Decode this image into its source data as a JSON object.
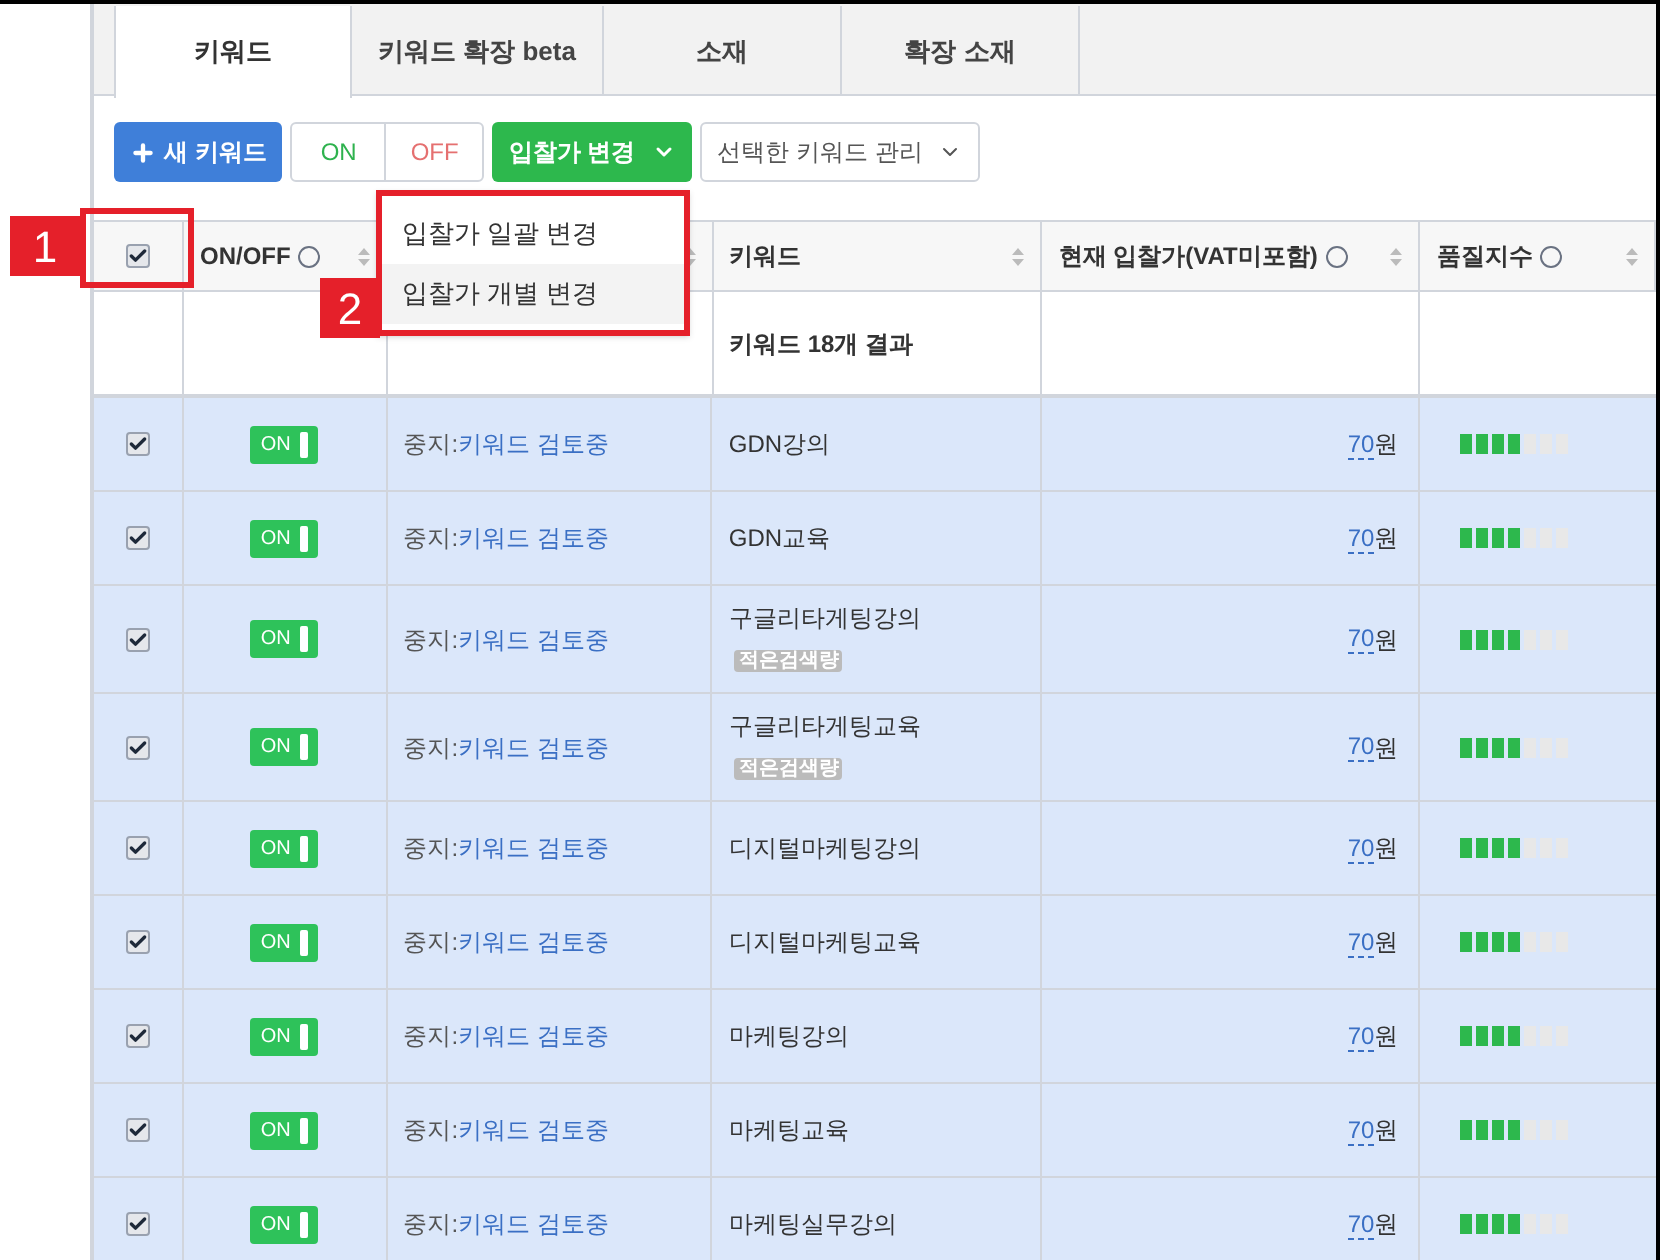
{
  "tabs": [
    {
      "label": "키워드",
      "selected": true
    },
    {
      "label": "키워드 확장 beta",
      "selected": false
    },
    {
      "label": "소재",
      "selected": false
    },
    {
      "label": "확장 소재",
      "selected": false
    }
  ],
  "toolbar": {
    "new_button": "새 키워드",
    "on_button": "ON",
    "off_button": "OFF",
    "bid_button": "입찰가 변경",
    "manage_button": "선택한 키워드 관리"
  },
  "bid_menu": {
    "items": [
      {
        "label": "입찰가 일괄 변경",
        "selected": false
      },
      {
        "label": "입찰가 개별 변경",
        "selected": true
      }
    ]
  },
  "annotations": [
    {
      "text": "1"
    },
    {
      "text": "2"
    }
  ],
  "table": {
    "header_checked": true,
    "columns": [
      {
        "kind": "help",
        "label": "ON/OFF"
      },
      {
        "kind": "blank"
      },
      {
        "kind": "plain",
        "label": "키워드"
      },
      {
        "kind": "help",
        "label": "현재 입찰가(VAT미포함)"
      },
      {
        "kind": "help",
        "label": "품질지수"
      }
    ],
    "summary": "키워드 18개 결과",
    "rows": [
      {
        "checked": true,
        "on": true,
        "toggle": "ON",
        "status": "중지:",
        "status_link": "키워드 검토중",
        "keyword": "GDN강의",
        "bid": "70",
        "unit": "원",
        "quality": {
          "level": 0.57
        }
      },
      {
        "checked": true,
        "on": true,
        "toggle": "ON",
        "status": "중지:",
        "status_link": "키워드 검토중",
        "keyword": "GDN교육",
        "bid": "70",
        "unit": "원",
        "quality": {
          "level": 0.57
        }
      },
      {
        "checked": true,
        "on": true,
        "toggle": "ON",
        "status": "중지:",
        "status_link": "키워드 검토중",
        "keyword": "구글리타게팅강의",
        "badge": "적은검색량",
        "bid": "70",
        "unit": "원",
        "quality": {
          "level": 0.57
        }
      },
      {
        "checked": true,
        "on": true,
        "toggle": "ON",
        "status": "중지:",
        "status_link": "키워드 검토중",
        "keyword": "구글리타게팅교육",
        "badge": "적은검색량",
        "bid": "70",
        "unit": "원",
        "quality": {
          "level": 0.57
        }
      },
      {
        "checked": true,
        "on": true,
        "toggle": "ON",
        "status": "중지:",
        "status_link": "키워드 검토중",
        "keyword": "디지털마케팅강의",
        "bid": "70",
        "unit": "원",
        "quality": {
          "level": 0.57
        }
      },
      {
        "checked": true,
        "on": true,
        "toggle": "ON",
        "status": "중지:",
        "status_link": "키워드 검토중",
        "keyword": "디지털마케팅교육",
        "bid": "70",
        "unit": "원",
        "quality": {
          "level": 0.57
        }
      },
      {
        "checked": true,
        "on": true,
        "toggle": "ON",
        "status": "중지:",
        "status_link": "키워드 검토중",
        "keyword": "마케팅강의",
        "bid": "70",
        "unit": "원",
        "quality": {
          "level": 0.57
        }
      },
      {
        "checked": true,
        "on": true,
        "toggle": "ON",
        "status": "중지:",
        "status_link": "키워드 검토중",
        "keyword": "마케팅교육",
        "bid": "70",
        "unit": "원",
        "quality": {
          "level": 0.57
        }
      },
      {
        "checked": true,
        "on": true,
        "toggle": "ON",
        "status": "중지:",
        "status_link": "키워드 검토중",
        "keyword": "마케팅실무강의",
        "bid": "70",
        "unit": "원",
        "quality": {
          "level": 0.57
        }
      }
    ]
  }
}
